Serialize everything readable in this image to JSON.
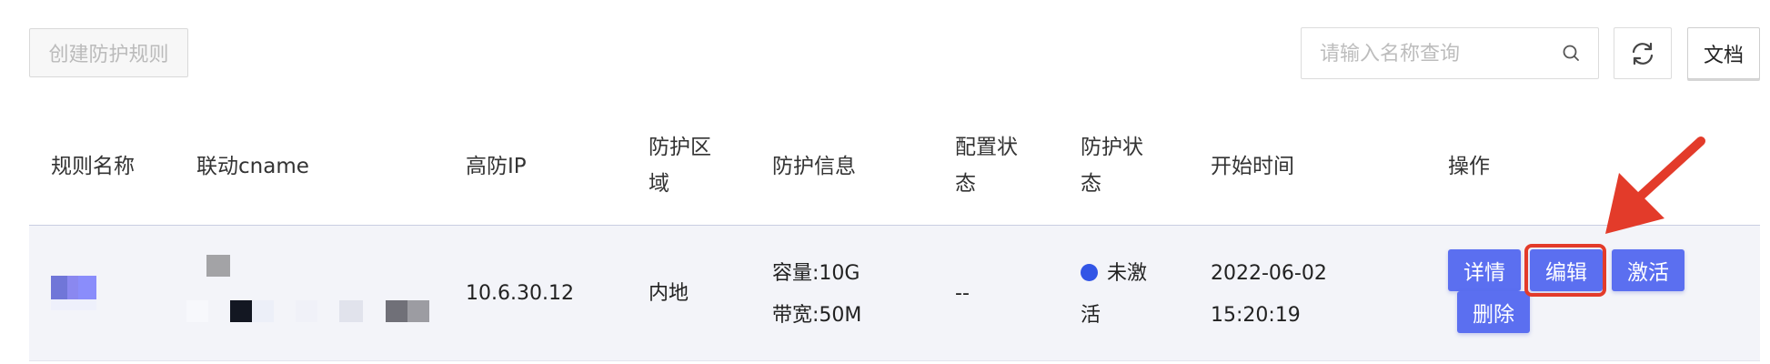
{
  "toolbar": {
    "create_label": "创建防护规则",
    "search_placeholder": "请输入名称查询",
    "doc_label": "文档"
  },
  "table": {
    "headers": {
      "rule_name": "规则名称",
      "cname": "联动cname",
      "ip": "高防IP",
      "region_l1": "防护区",
      "region_l2": "域",
      "info": "防护信息",
      "config_l1": "配置状",
      "config_l2": "态",
      "protect_l1": "防护状",
      "protect_l2": "态",
      "start_time": "开始时间",
      "actions": "操作"
    },
    "rows": [
      {
        "ip": "10.6.30.12",
        "region": "内地",
        "capacity": "容量:10G",
        "bandwidth": "带宽:50M",
        "config_status": "--",
        "protect_status_l1": "未激",
        "protect_status_l2": "活",
        "start_date": "2022-06-02",
        "start_clock": "15:20:19",
        "actions": {
          "detail": "详情",
          "edit": "编辑",
          "activate": "激活",
          "delete": "删除"
        }
      }
    ]
  },
  "colors": {
    "primary_button": "#5b6ff0",
    "status_dot": "#3255e6",
    "annotation_red": "#e33b2a"
  },
  "icons": [
    "search-icon",
    "refresh-icon",
    "annotation-arrow-icon"
  ]
}
